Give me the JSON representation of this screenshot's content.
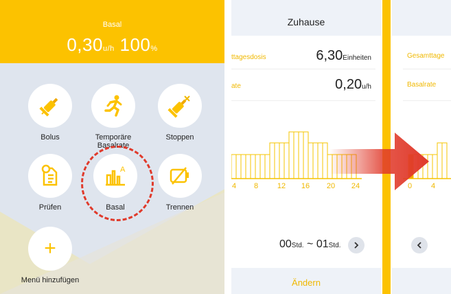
{
  "left": {
    "header": {
      "title": "Basal",
      "rate": "0,30",
      "rate_unit": "u/h",
      "percent": "100",
      "percent_unit": "%"
    },
    "tiles": [
      {
        "label": "Bolus",
        "icon": "syringe-icon"
      },
      {
        "label": "Temporäre Basalrate",
        "icon": "running-person-icon"
      },
      {
        "label": "Stoppen",
        "icon": "syringe-stop-icon"
      },
      {
        "label": "Prüfen",
        "icon": "document-check-icon"
      },
      {
        "label": "Basal",
        "icon": "basal-chart-icon"
      },
      {
        "label": "Trennen",
        "icon": "disconnect-icon"
      }
    ],
    "add_label": "Menü hinzufügen",
    "add_icon_glyph": "+"
  },
  "middle": {
    "title": "Zuhause",
    "total_label": "ttagesdosis",
    "total_value": "6,30",
    "total_unit": "Einheiten",
    "rate_label": "ate",
    "rate_value": "0,20",
    "rate_unit": "u/h",
    "chart_ticks": [
      "4",
      "8",
      "12",
      "16",
      "20",
      "24"
    ],
    "range_start": "00",
    "range_start_unit": "Std.",
    "range_sep": "~",
    "range_end": "01",
    "range_end_unit": "Std.",
    "edit_label": "Ändern"
  },
  "right": {
    "total_label": "Gesamttage",
    "rate_label": "Basalrate",
    "chart_ticks": [
      "0",
      "4"
    ]
  },
  "colors": {
    "accent": "#fcc200",
    "label": "#f0b800",
    "highlight": "#e03a2b"
  }
}
